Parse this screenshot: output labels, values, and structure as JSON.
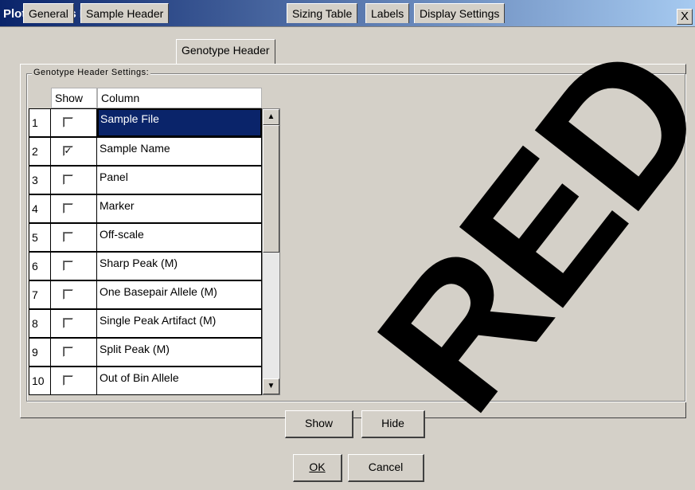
{
  "window": {
    "title": "Plot Settings Editor",
    "close_label": "X"
  },
  "tabs": [
    {
      "label": "General"
    },
    {
      "label": "Sample Header"
    },
    {
      "label": "Genotype Header",
      "active": true
    },
    {
      "label": "Sizing Table"
    },
    {
      "label": "Labels"
    },
    {
      "label": "Display Settings"
    }
  ],
  "group": {
    "label": "Genotype Header Settings:"
  },
  "table": {
    "headers": {
      "show": "Show",
      "column": "Column"
    },
    "rows": [
      {
        "num": "1",
        "checked": false,
        "column": "Sample File",
        "selected": true
      },
      {
        "num": "2",
        "checked": true,
        "column": "Sample Name"
      },
      {
        "num": "3",
        "checked": false,
        "column": "Panel"
      },
      {
        "num": "4",
        "checked": false,
        "column": "Marker"
      },
      {
        "num": "5",
        "checked": false,
        "column": "Off-scale"
      },
      {
        "num": "6",
        "checked": false,
        "column": "Sharp Peak (M)"
      },
      {
        "num": "7",
        "checked": false,
        "column": "One Basepair Allele (M)"
      },
      {
        "num": "8",
        "checked": false,
        "column": "Single Peak Artifact (M)"
      },
      {
        "num": "9",
        "checked": false,
        "column": "Split Peak (M)"
      },
      {
        "num": "10",
        "checked": false,
        "column": "Out of Bin Allele"
      }
    ]
  },
  "buttons": {
    "show": "Show",
    "hide": "Hide",
    "ok": "OK",
    "cancel": "Cancel"
  },
  "scroll": {
    "up_icon": "▲",
    "down_icon": "▼"
  },
  "watermark": "RED"
}
